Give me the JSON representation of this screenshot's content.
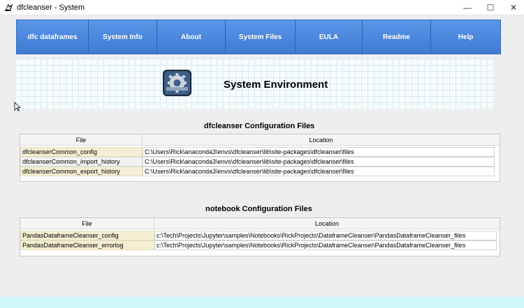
{
  "window": {
    "title": "dfcleanser - System",
    "minimize_glyph": "—",
    "maximize_glyph": "☐",
    "close_glyph": "✕"
  },
  "nav": {
    "items": [
      {
        "label": "dfc dataframes"
      },
      {
        "label": "System Info"
      },
      {
        "label": "About"
      },
      {
        "label": "System Files"
      },
      {
        "label": "EULA"
      },
      {
        "label": "Readme"
      },
      {
        "label": "Help"
      }
    ]
  },
  "banner": {
    "title": "System Environment",
    "icon": "gear-settings-icon"
  },
  "dfc_config": {
    "title": "dfcleanser Configuration Files",
    "headers": [
      "File",
      "Location"
    ],
    "rows": [
      {
        "file": "dfcleanserCommon_config",
        "location": "C:\\Users\\Rick\\anaconda3\\envs\\dfcleanser\\lib\\site-packages\\dfcleanser\\files"
      },
      {
        "file": "dfcleanserCommon_import_history",
        "location": "C:\\Users\\Rick\\anaconda3\\envs\\dfcleanser\\lib\\site-packages\\dfcleanser\\files"
      },
      {
        "file": "dfcleanserCommon_export_history",
        "location": "C:\\Users\\Rick\\anaconda3\\envs\\dfcleanser\\lib\\site-packages\\dfcleanser\\files"
      }
    ]
  },
  "nb_config": {
    "title": "notebook Configuration Files",
    "headers": [
      "File",
      "Location"
    ],
    "rows": [
      {
        "file": "PandasDataframeCleanser_config",
        "location": "c:\\Tech\\Projects\\Jupyter\\samples\\Notebooks\\RickProjects\\DataframeCleanser\\PandasDataframeCleanser_files"
      },
      {
        "file": "PandasDataframeCleanser_errorlog",
        "location": "c:\\Tech\\Projects\\Jupyter\\samples\\Notebooks\\RickProjects\\DataframeCleanser\\PandasDataframeCleanser_files"
      }
    ]
  },
  "colors": {
    "nav_blue": "#4b87dc",
    "file_cell_bg": "#f4efd2",
    "footer_strip": "#ccf7f8"
  }
}
